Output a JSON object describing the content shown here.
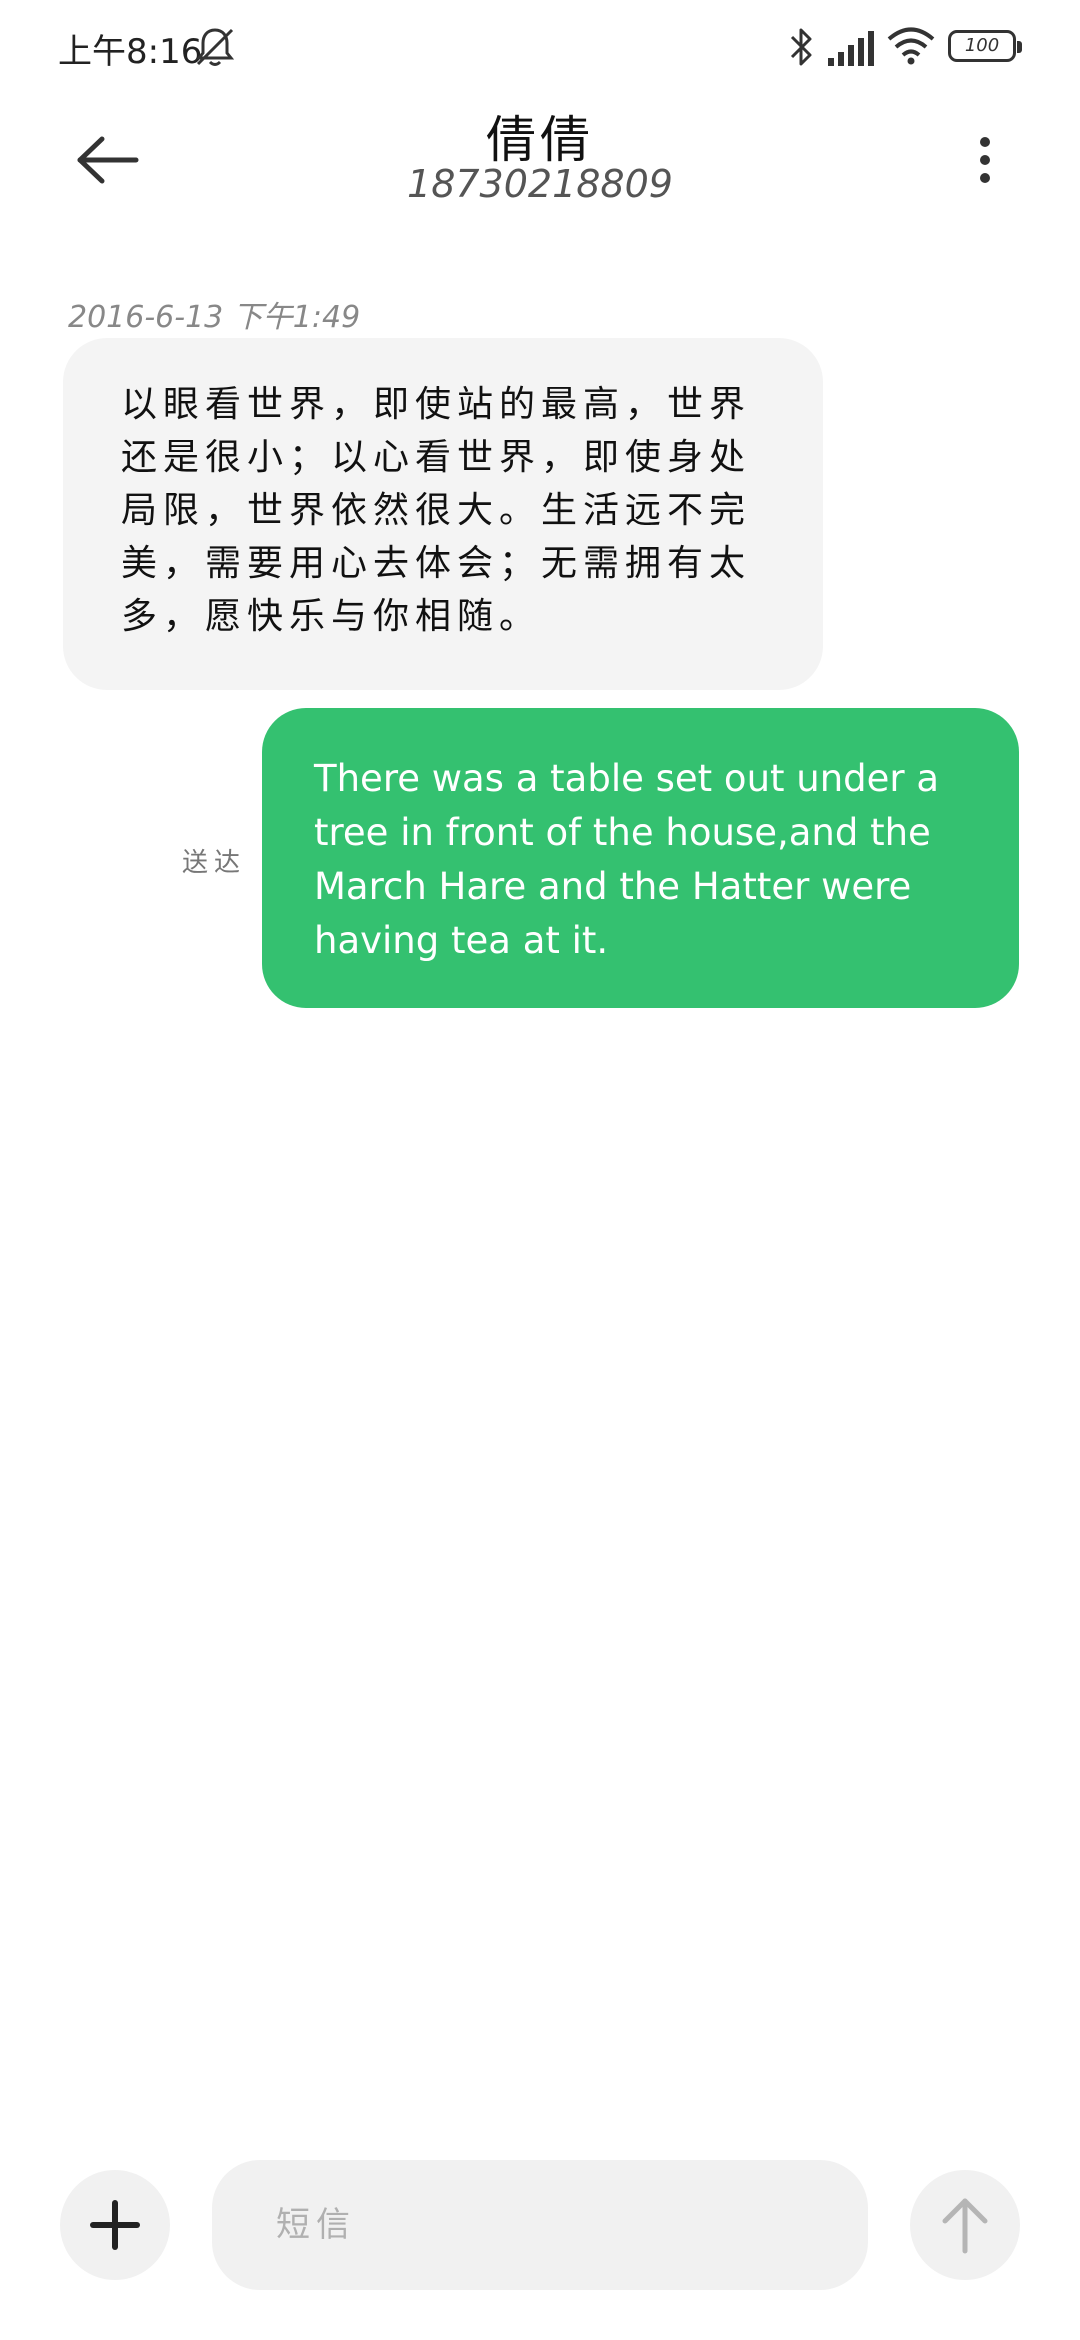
{
  "status_bar": {
    "time": "上午8:16",
    "battery": "100",
    "icons": [
      "mute-bell-icon",
      "bluetooth-icon",
      "signal-icon",
      "wifi-icon",
      "battery-icon"
    ]
  },
  "header": {
    "contact_name": "倩倩",
    "contact_number": "18730218809",
    "icons": [
      "back-arrow-icon",
      "more-vertical-icon"
    ]
  },
  "messages": [
    {
      "direction": "incoming",
      "timestamp": "2016-6-13 下午1:49",
      "text": "以眼看世界，即使站的最高，世界还是很小；以心看世界，即使身处局限，世界依然很大。生活远不完美，需要用心去体会；无需拥有太多，愿快乐与你相随。"
    },
    {
      "direction": "outgoing",
      "status": "送达",
      "text": "There was a table set out under a tree in front of the house,and the March Hare and the Hatter were having tea at it."
    }
  ],
  "compose": {
    "placeholder": "短信",
    "icons": [
      "plus-icon",
      "send-arrow-up-icon"
    ]
  },
  "colors": {
    "outgoing_bubble": "#34c170",
    "incoming_bubble": "#f4f4f4",
    "compose_background": "#f1f1f1"
  }
}
